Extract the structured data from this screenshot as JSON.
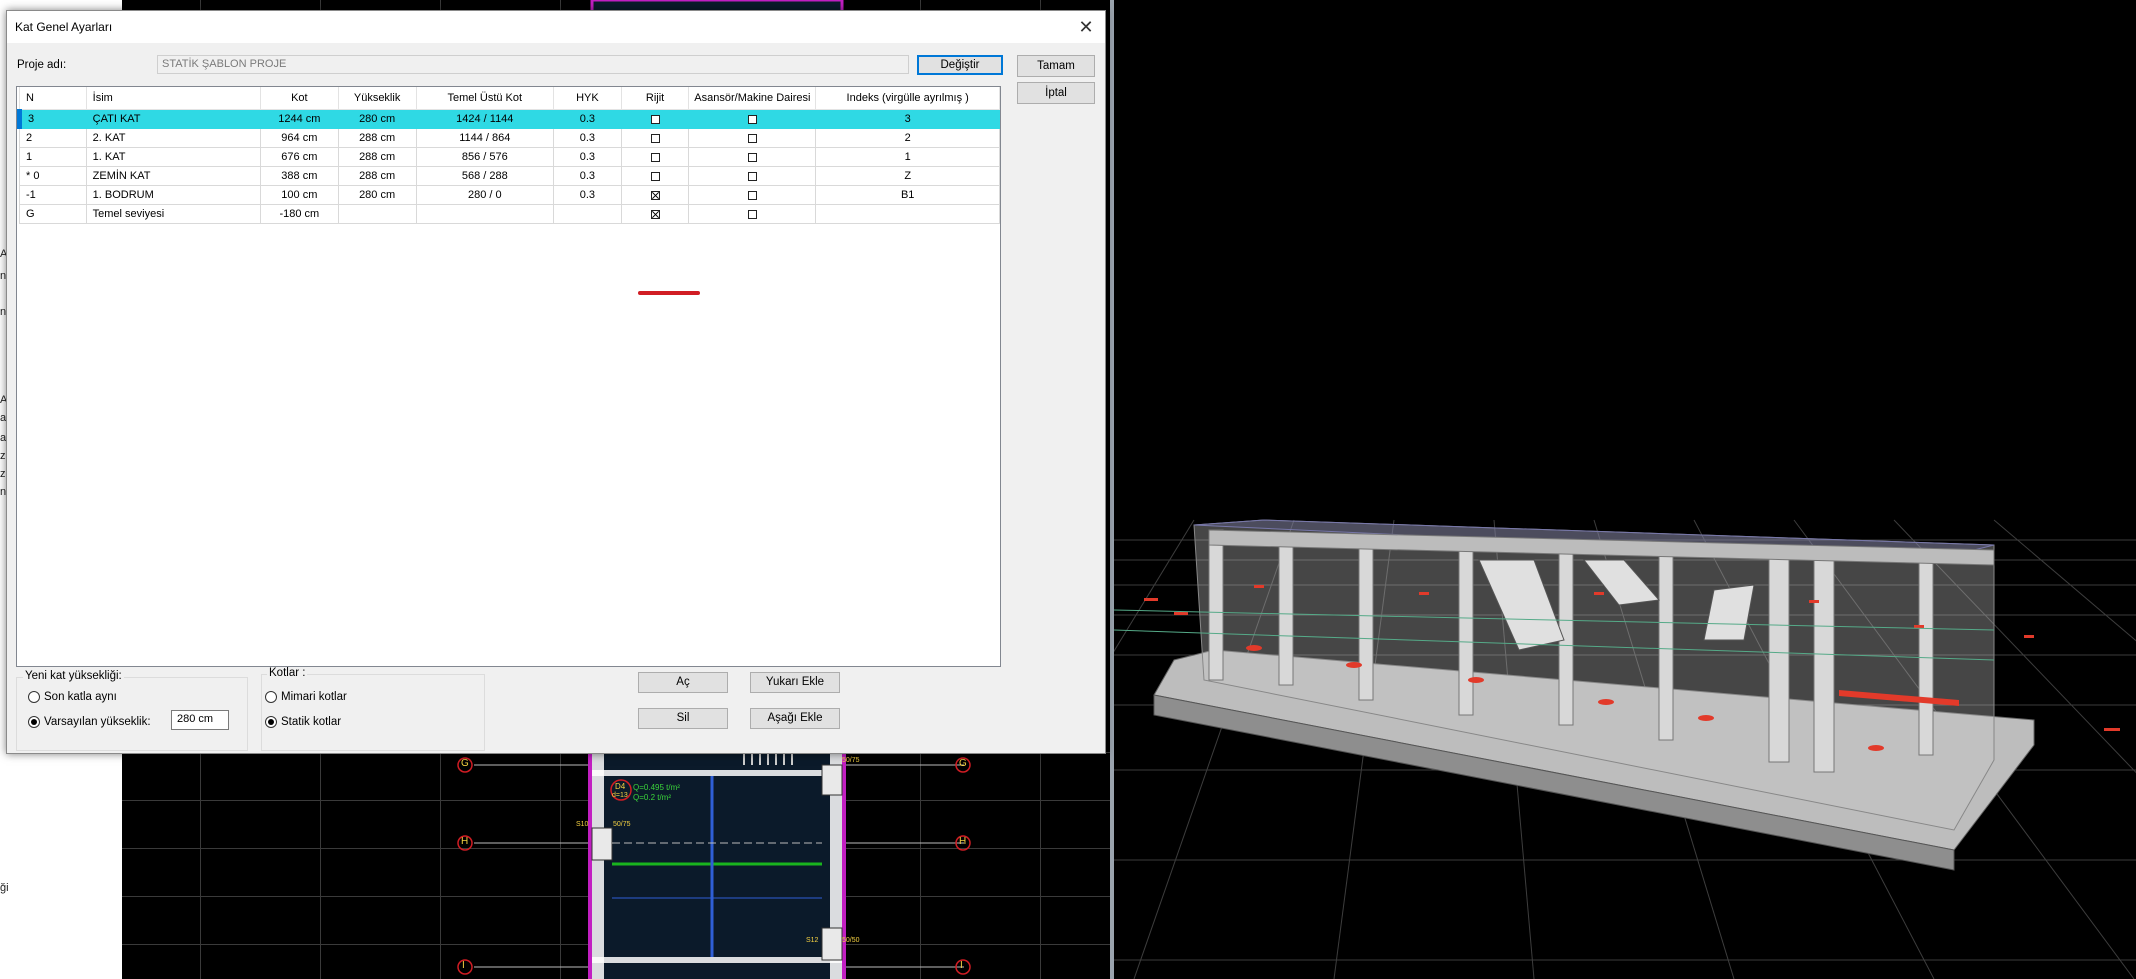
{
  "dialog": {
    "title": "Kat Genel Ayarları",
    "project_label": "Proje adı:",
    "project_value": "STATİK ŞABLON PROJE",
    "change_button": "Değiştir",
    "ok_button": "Tamam",
    "cancel_button": "İptal"
  },
  "table": {
    "columns": [
      "N",
      "İsim",
      "Kot",
      "Yükseklik",
      "Temel Üstü Kot",
      "HYK",
      "Rijit",
      "Asansör/Makine Dairesi",
      "Indeks (virgülle ayrılmış )"
    ],
    "rows": [
      {
        "n": "3",
        "name": "ÇATI KAT",
        "kot": "1244 cm",
        "height": "280 cm",
        "temel": "1424 / 1144",
        "hyk": "0.3",
        "rijit": false,
        "asansor": false,
        "index": "3",
        "selected": true
      },
      {
        "n": "2",
        "name": "2. KAT",
        "kot": "964 cm",
        "height": "288 cm",
        "temel": "1144 / 864",
        "hyk": "0.3",
        "rijit": false,
        "asansor": false,
        "index": "2"
      },
      {
        "n": "1",
        "name": "1. KAT",
        "kot": "676 cm",
        "height": "288 cm",
        "temel": "856 / 576",
        "hyk": "0.3",
        "rijit": false,
        "asansor": false,
        "index": "1"
      },
      {
        "n": "* 0",
        "name": "ZEMİN KAT",
        "kot": "388 cm",
        "height": "288 cm",
        "temel": "568 / 288",
        "hyk": "0.3",
        "rijit": false,
        "asansor": false,
        "index": "Z"
      },
      {
        "n": "-1",
        "name": "1. BODRUM",
        "kot": "100 cm",
        "height": "280 cm",
        "temel": "280 / 0",
        "hyk": "0.3",
        "rijit": true,
        "asansor": false,
        "index": "B1"
      },
      {
        "n": "G",
        "name": "Temel seviyesi",
        "kot": "-180 cm",
        "height": "",
        "temel": "",
        "hyk": "",
        "rijit": true,
        "asansor": false,
        "index": ""
      }
    ]
  },
  "new_floor": {
    "group_label": "Yeni kat yüksekliği:",
    "option_same": "Son katla aynı",
    "option_default": "Varsayılan yükseklik:",
    "selected": "default",
    "height_value": "280 cm"
  },
  "kotlar": {
    "group_label": "Kotlar :",
    "option_mimari": "Mimari kotlar",
    "option_statik": "Statik kotlar",
    "selected": "statik"
  },
  "actions": {
    "open": "Aç",
    "delete": "Sil",
    "add_above": "Yukarı Ekle",
    "add_below": "Aşağı Ekle"
  },
  "cad": {
    "axis_labels": [
      "G",
      "G",
      "H",
      "H",
      "I",
      "I"
    ],
    "load_text_1": "Q=0.495 t/m²",
    "load_text_2": "Q=0.2 t/m²",
    "slab_label": "D4",
    "slab_sub": "d=13",
    "col_1": "S10",
    "col_2": "50/75",
    "col_3": "S12",
    "col_4": "50/50",
    "col_5": "50/75"
  },
  "colors": {
    "selection": "#2fd9e4",
    "accent": "#0078d7",
    "red_mark": "#d11d24"
  }
}
